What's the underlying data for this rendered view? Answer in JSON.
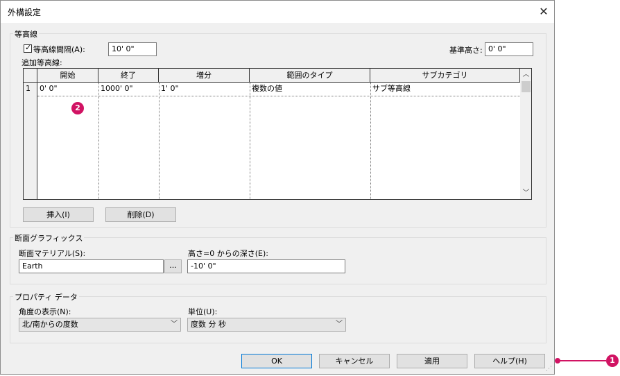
{
  "window": {
    "title": "外構設定"
  },
  "contours": {
    "group_title": "等高線",
    "interval_label": "等高線間隔(A):",
    "interval_checked": true,
    "interval_value": "10'  0\"",
    "base_height_label": "基準高さ:",
    "base_height_value": "0'  0\"",
    "additional_label": "追加等高線:",
    "table": {
      "columns": [
        "開始",
        "終了",
        "増分",
        "範囲のタイプ",
        "サブカテゴリ"
      ],
      "rows": [
        {
          "num": "1",
          "cells": [
            "0'  0\"",
            "1000'  0\"",
            "1'  0\"",
            "複数の値",
            "サブ等高線"
          ]
        }
      ]
    },
    "insert_button": "挿入(I)",
    "delete_button": "削除(D)"
  },
  "section_graphics": {
    "group_title": "断面グラフィックス",
    "material_label": "断面マテリアル(S):",
    "material_value": "Earth",
    "browse_button": "...",
    "depth_label": "高さ=0 からの深さ(E):",
    "depth_value": "-10'  0\""
  },
  "property_data": {
    "group_title": "プロパティ データ",
    "angle_label": "角度の表示(N):",
    "angle_value": "北/南からの度数",
    "units_label": "単位(U):",
    "units_value": "度数 分 秒"
  },
  "footer": {
    "ok": "OK",
    "cancel": "キャンセル",
    "apply": "適用",
    "help": "ヘルプ(H)"
  },
  "callouts": {
    "one": "1",
    "two": "2",
    "color": "#d11363"
  }
}
